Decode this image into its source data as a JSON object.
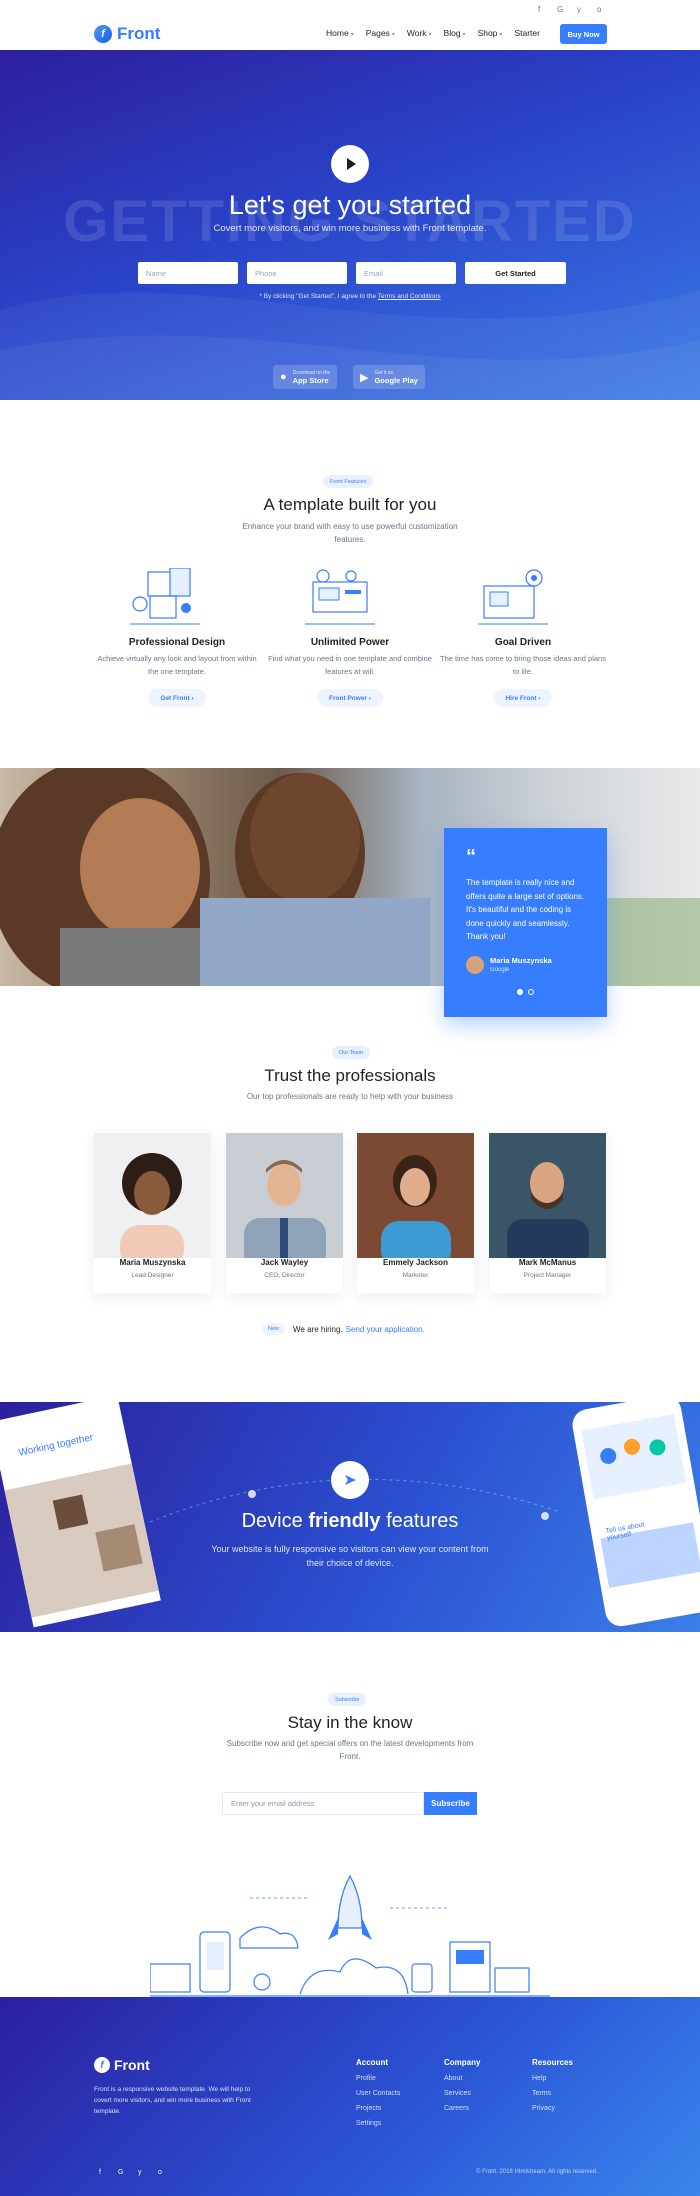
{
  "topbar": {
    "social": [
      "f",
      "G",
      "y",
      "o"
    ]
  },
  "brand": {
    "name": "Front",
    "mark": "f"
  },
  "nav": {
    "items": [
      {
        "label": "Home",
        "caret": "▾"
      },
      {
        "label": "Pages",
        "caret": "▾"
      },
      {
        "label": "Work",
        "caret": "▾"
      },
      {
        "label": "Blog",
        "caret": "▾"
      },
      {
        "label": "Shop",
        "caret": "▾"
      },
      {
        "label": "Starter",
        "caret": ""
      }
    ],
    "cta": "Buy Now"
  },
  "hero": {
    "ghost": "GETTING STARTED",
    "title": "Let's get you started",
    "subtitle": "Covert more visitors, and win more business with Front template.",
    "fields": {
      "name": "Name",
      "phone": "Phone",
      "email": "Email"
    },
    "button": "Get Started",
    "agree_prefix": "* By clicking \"Get Started\", I agree to the",
    "agree_link": "Terms and Conditions",
    "stores": [
      {
        "small": "Download on the",
        "big": "App Store",
        "icon": ""
      },
      {
        "small": "Get it on",
        "big": "Google Play",
        "icon": "▶"
      }
    ]
  },
  "features": {
    "chip": "Front Features",
    "title": "A template built for you",
    "subtitle": "Enhance your brand with easy to use powerful customization features.",
    "items": [
      {
        "title": "Professional Design",
        "desc": "Achieve virtually any look and layout from within the one template.",
        "button": "Get Front ›"
      },
      {
        "title": "Unlimited Power",
        "desc": "Find what you need in one template and combine features at will.",
        "button": "Front Power ›"
      },
      {
        "title": "Goal Driven",
        "desc": "The time has come to bring those ideas and plans to life.",
        "button": "Hire Front ›"
      }
    ]
  },
  "testimonial": {
    "quote_mark": "“",
    "text": "The template is really nice and offers quite a large set of options. It's beautiful and the coding is done quickly and seamlessly. Thank you!",
    "name": "Maria Muszynska",
    "company": "Google"
  },
  "team": {
    "chip": "Our Team",
    "title": "Trust the professionals",
    "subtitle": "Our top professionals are ready to help with your business",
    "members": [
      {
        "name": "Maria Muszynska",
        "role": "Lead Designer"
      },
      {
        "name": "Jack Wayley",
        "role": "CEO, Director"
      },
      {
        "name": "Emmely Jackson",
        "role": "Marketer"
      },
      {
        "name": "Mark McManus",
        "role": "Project Manager"
      }
    ],
    "hiring": {
      "badge": "New",
      "text": "We are hiring.",
      "link": "Send your application."
    }
  },
  "device": {
    "icon": "➤",
    "title_pre": "Device ",
    "title_bold": "friendly",
    "title_post": " features",
    "subtitle": "Your website is fully responsive so visitors can view your content from their choice of device.",
    "mock_left": "Working together",
    "mock_right": "Tell us about yourself"
  },
  "subscribe": {
    "chip": "Subscribe",
    "title": "Stay in the know",
    "subtitle": "Subscribe now and get special offers on the latest developments from Front.",
    "placeholder": "Enter your email address",
    "button": "Subscribe"
  },
  "footer": {
    "desc": "Front is a responsive website template. We will help to covert more visitors, and win more business with Front template.",
    "columns": [
      {
        "title": "Account",
        "links": [
          "Profile",
          "User Contacts",
          "Projects",
          "Settings"
        ]
      },
      {
        "title": "Company",
        "links": [
          "About",
          "Services",
          "Careers"
        ]
      },
      {
        "title": "Resources",
        "links": [
          "Help",
          "Terms",
          "Privacy"
        ]
      }
    ],
    "social": [
      "f",
      "G",
      "y",
      "o"
    ],
    "copyright": "© Front. 2018 Htmlstream. All rights reserved."
  },
  "colors": {
    "primary": "#377dff",
    "hero_dark": "#2d1f9c",
    "text": "#1e2022",
    "muted": "#677788"
  }
}
